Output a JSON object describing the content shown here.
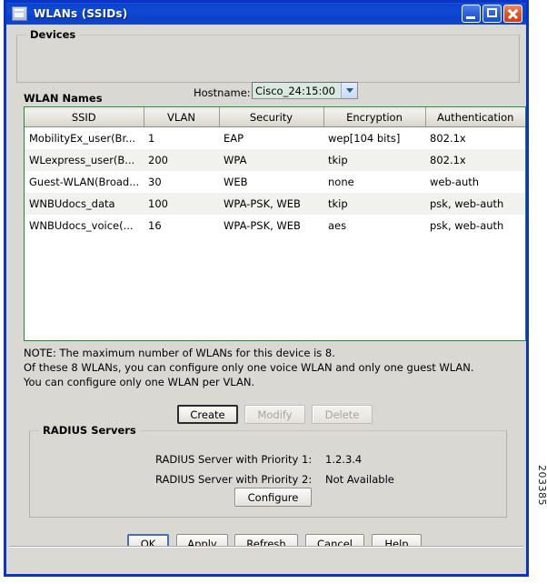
{
  "window": {
    "title": "WLANs (SSIDs)",
    "icon": "window-icon",
    "buttons": {
      "minimize": "minimize-icon",
      "maximize": "maximize-icon",
      "close": "close-icon"
    }
  },
  "devices": {
    "group_title": "Devices",
    "hostname_label": "Hostname:",
    "hostname_value": "Cisco_24:15:00"
  },
  "wlan_names": {
    "group_title": "WLAN Names",
    "columns": [
      "SSID",
      "VLAN",
      "Security",
      "Encryption",
      "Authentication"
    ],
    "rows": [
      {
        "ssid": "MobilityEx_user(Br...",
        "vlan": "1",
        "security": "EAP",
        "encryption": "wep[104 bits]",
        "authentication": "802.1x"
      },
      {
        "ssid": "WLexpress_user(B...",
        "vlan": "200",
        "security": "WPA",
        "encryption": "tkip",
        "authentication": "802.1x"
      },
      {
        "ssid": "Guest-WLAN(Broad...",
        "vlan": "30",
        "security": "WEB",
        "encryption": "none",
        "authentication": "web-auth"
      },
      {
        "ssid": "WNBUdocs_data",
        "vlan": "100",
        "security": "WPA-PSK, WEB",
        "encryption": "tkip",
        "authentication": "psk, web-auth"
      },
      {
        "ssid": "WNBUdocs_voice(...",
        "vlan": "16",
        "security": "WPA-PSK, WEB",
        "encryption": "aes",
        "authentication": "psk, web-auth"
      }
    ]
  },
  "note": {
    "line1": "NOTE: The maximum number of WLANs for this device is 8.",
    "line2": "Of these 8 WLANs, you can configure only one voice WLAN and only one guest WLAN.",
    "line3": "You can configure only one WLAN per VLAN."
  },
  "wlan_actions": {
    "create": "Create",
    "modify": "Modify",
    "delete": "Delete"
  },
  "radius": {
    "group_title": "RADIUS Servers",
    "priority1_label": "RADIUS Server with Priority 1:",
    "priority1_value": "1.2.3.4",
    "priority2_label": "RADIUS Server with Priority 2:",
    "priority2_value": "Not Available",
    "configure": "Configure"
  },
  "footer": {
    "ok": "OK",
    "apply": "Apply",
    "refresh": "Refresh",
    "cancel": "Cancel",
    "help": "Help"
  },
  "watermark": "203385",
  "colors": {
    "titlebar_blue": "#0a44cf",
    "frame_blue": "#0a33c8",
    "table_border_green": "#1f8a3c",
    "dialog_face": "#d9d8d2",
    "combo_field": "#d8e9dd"
  }
}
